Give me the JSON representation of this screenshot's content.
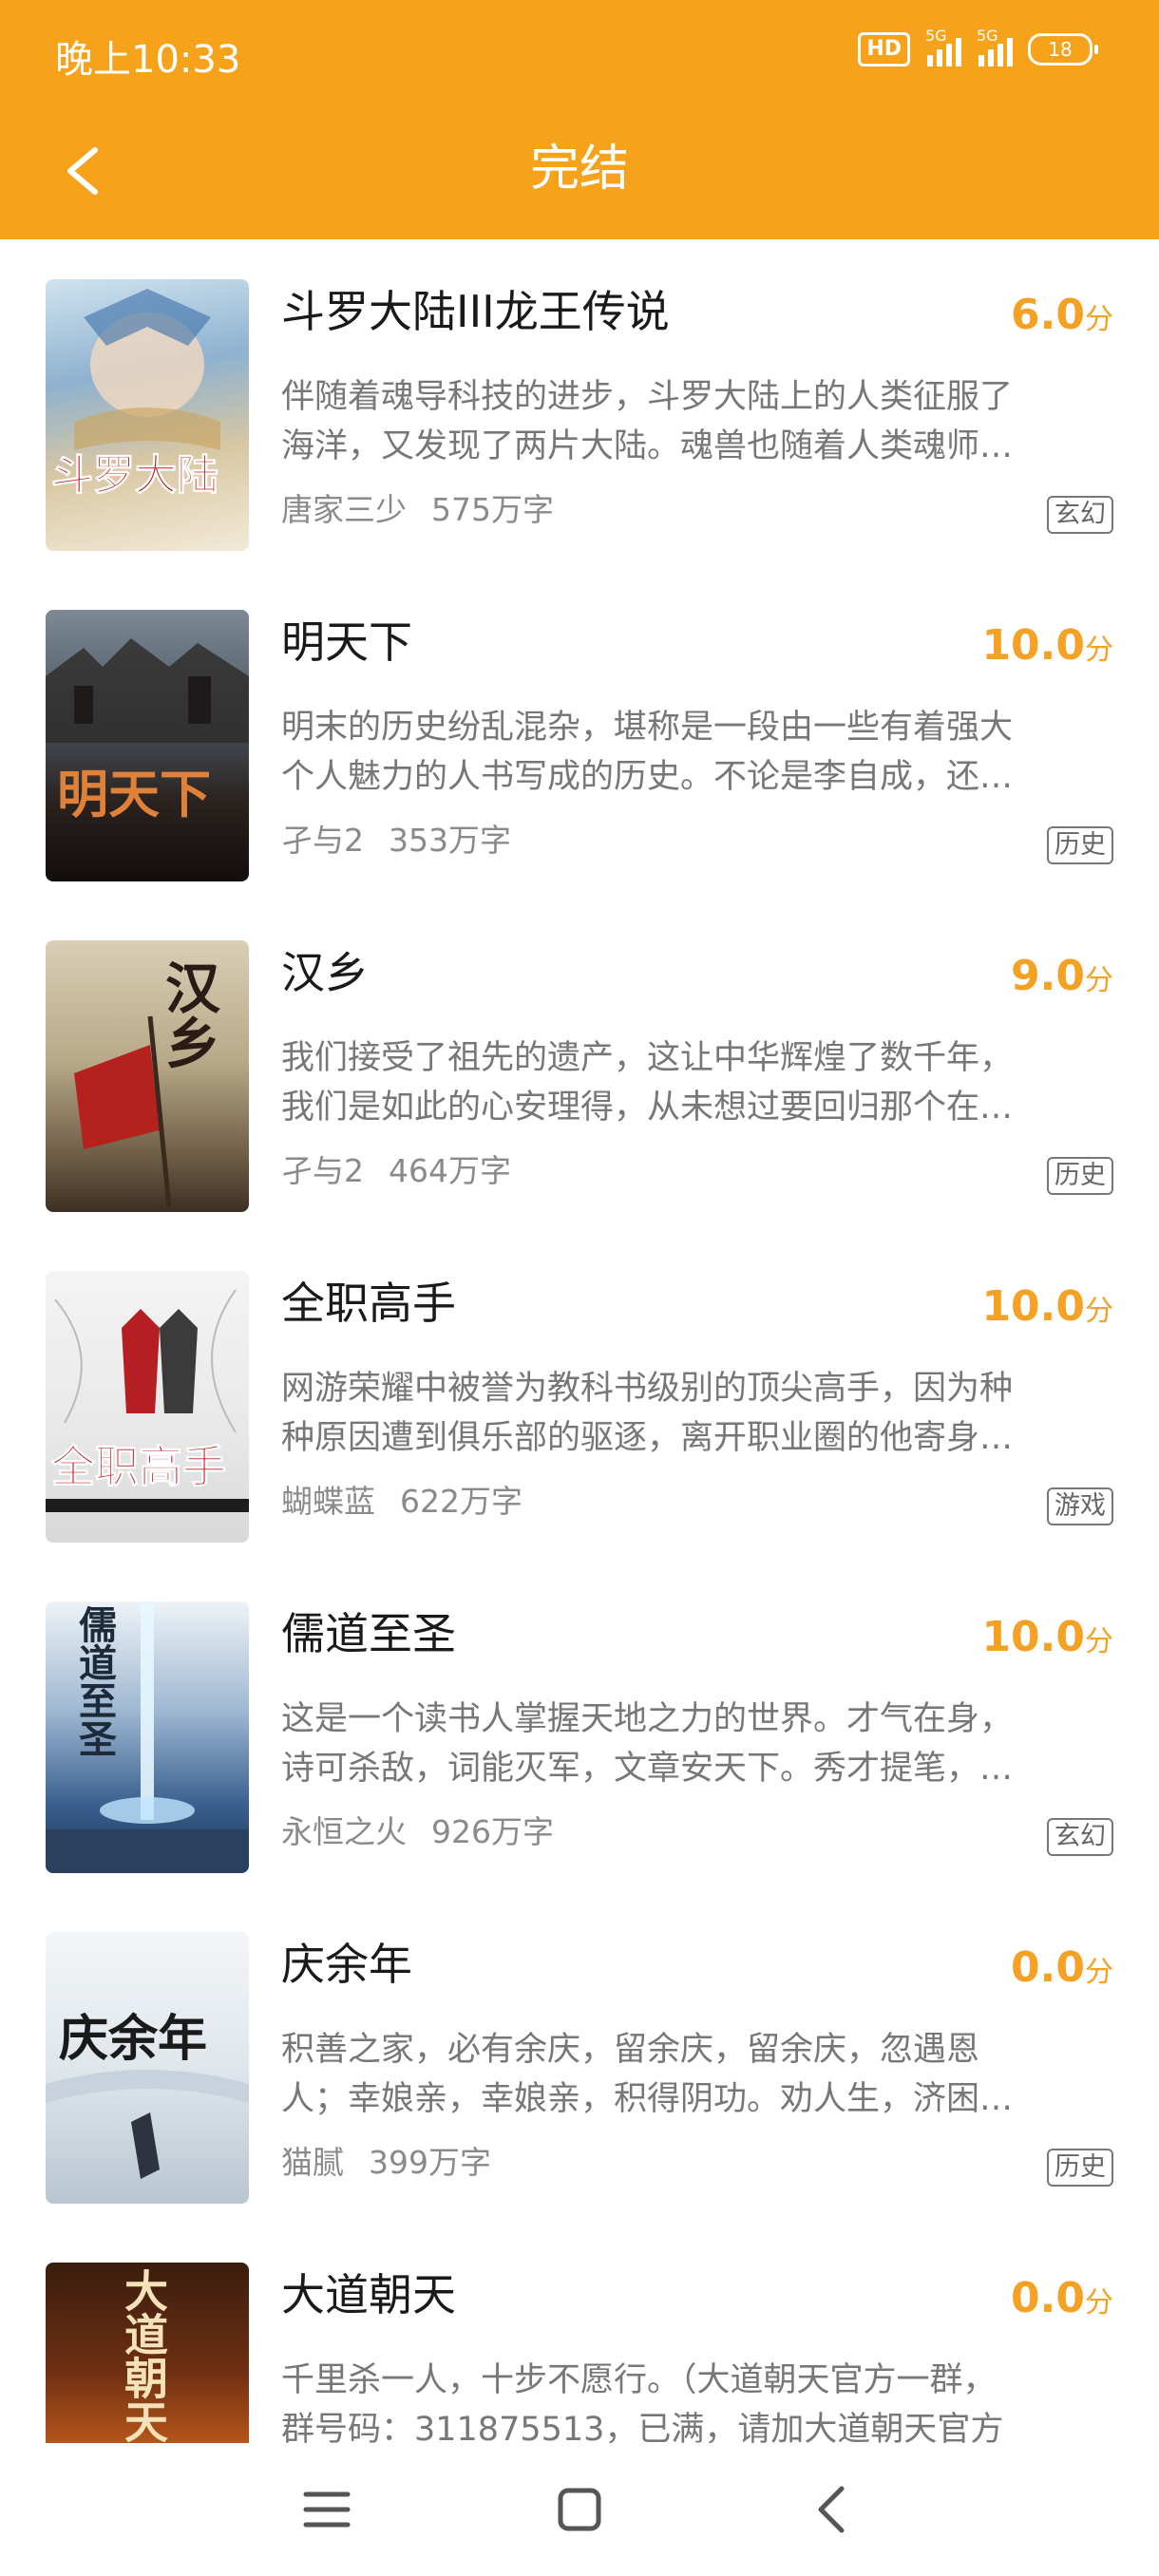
{
  "status_bar": {
    "time": "晚上10:33",
    "hd_label": "HD",
    "signal1_label": "5G",
    "signal2_label": "5G",
    "battery": "18"
  },
  "header": {
    "title": "完结",
    "back_icon": "chevron-left-icon",
    "background": "#f7a21b"
  },
  "score_color": "#f4a124",
  "books": [
    {
      "title": "斗罗大陆III龙王传说",
      "score": "6.0",
      "score_unit": "分",
      "desc_line1": "伴随着魂导科技的进步，斗罗大陆上的人类征服了",
      "desc_line2": "海洋，又发现了两片大陆。魂兽也随着人类魂师…",
      "author": "唐家三少",
      "words": "575万字",
      "tag": "玄幻",
      "cover_text": "斗罗大陆"
    },
    {
      "title": "明天下",
      "score": "10.0",
      "score_unit": "分",
      "desc_line1": "明末的历史纷乱混杂，堪称是一段由一些有着强大",
      "desc_line2": "个人魅力的人书写成的历史。不论是李自成，还…",
      "author": "孑与2",
      "words": "353万字",
      "tag": "历史",
      "cover_text": "明天下"
    },
    {
      "title": "汉乡",
      "score": "9.0",
      "score_unit": "分",
      "desc_line1": "我们接受了祖先的遗产，这让中华辉煌了数千年，",
      "desc_line2": "我们是如此的心安理得，从未想过要回归那个在…",
      "author": "孑与2",
      "words": "464万字",
      "tag": "历史",
      "cover_text": "汉乡"
    },
    {
      "title": "全职高手",
      "score": "10.0",
      "score_unit": "分",
      "desc_line1": "网游荣耀中被誉为教科书级别的顶尖高手，因为种",
      "desc_line2": "种原因遭到俱乐部的驱逐，离开职业圈的他寄身…",
      "author": "蝴蝶蓝",
      "words": "622万字",
      "tag": "游戏",
      "cover_text": "全职高手"
    },
    {
      "title": "儒道至圣",
      "score": "10.0",
      "score_unit": "分",
      "desc_line1": "这是一个读书人掌握天地之力的世界。才气在身，",
      "desc_line2": "诗可杀敌，词能灭军，文章安天下。秀才提笔，…",
      "author": "永恒之火",
      "words": "926万字",
      "tag": "玄幻",
      "cover_text": "儒道至圣"
    },
    {
      "title": "庆余年",
      "score": "0.0",
      "score_unit": "分",
      "desc_line1": "积善之家，必有余庆，留余庆，留余庆，忽遇恩",
      "desc_line2": "人；幸娘亲，幸娘亲，积得阴功。劝人生，济困…",
      "author": "猫腻",
      "words": "399万字",
      "tag": "历史",
      "cover_text": "庆余年"
    },
    {
      "title": "大道朝天",
      "score": "0.0",
      "score_unit": "分",
      "desc_line1": "千里杀一人，十步不愿行。（大道朝天官方一群，",
      "desc_line2": "群号码：311875513，已满，请加大道朝天官方",
      "author": "",
      "words": "",
      "tag": "",
      "cover_text": "大道朝天"
    }
  ],
  "nav": {
    "menu_icon": "menu-icon",
    "home_icon": "home-square-icon",
    "back_icon": "back-triangle-icon"
  }
}
